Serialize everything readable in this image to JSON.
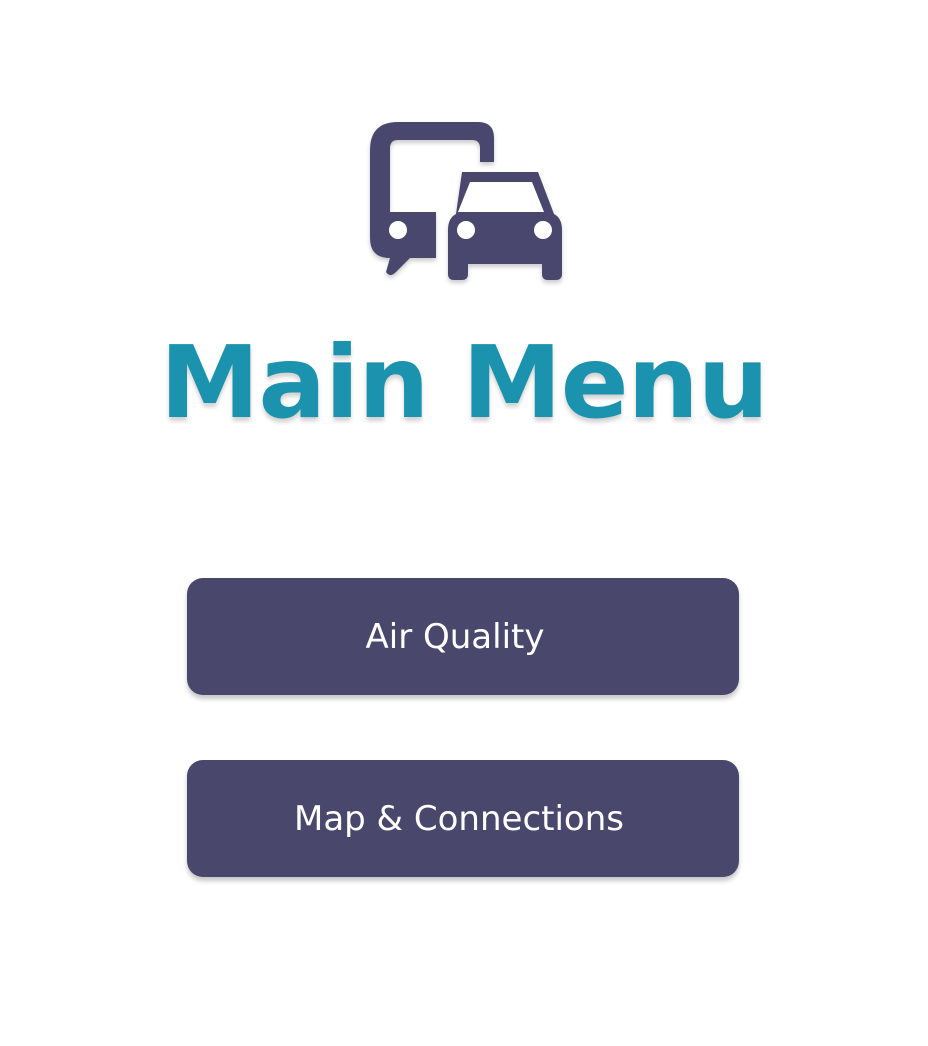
{
  "screen": {
    "title": "Main Menu",
    "logo_icon": "bus-and-car-icon"
  },
  "menu": {
    "buttons": [
      {
        "label": "Air Quality",
        "icon": ""
      },
      {
        "label": "Map & Connections",
        "icon": ""
      }
    ]
  },
  "colors": {
    "primary": "#4a476d",
    "accent": "#1b93ae",
    "background": "#ffffff",
    "button_text": "#ffffff"
  }
}
